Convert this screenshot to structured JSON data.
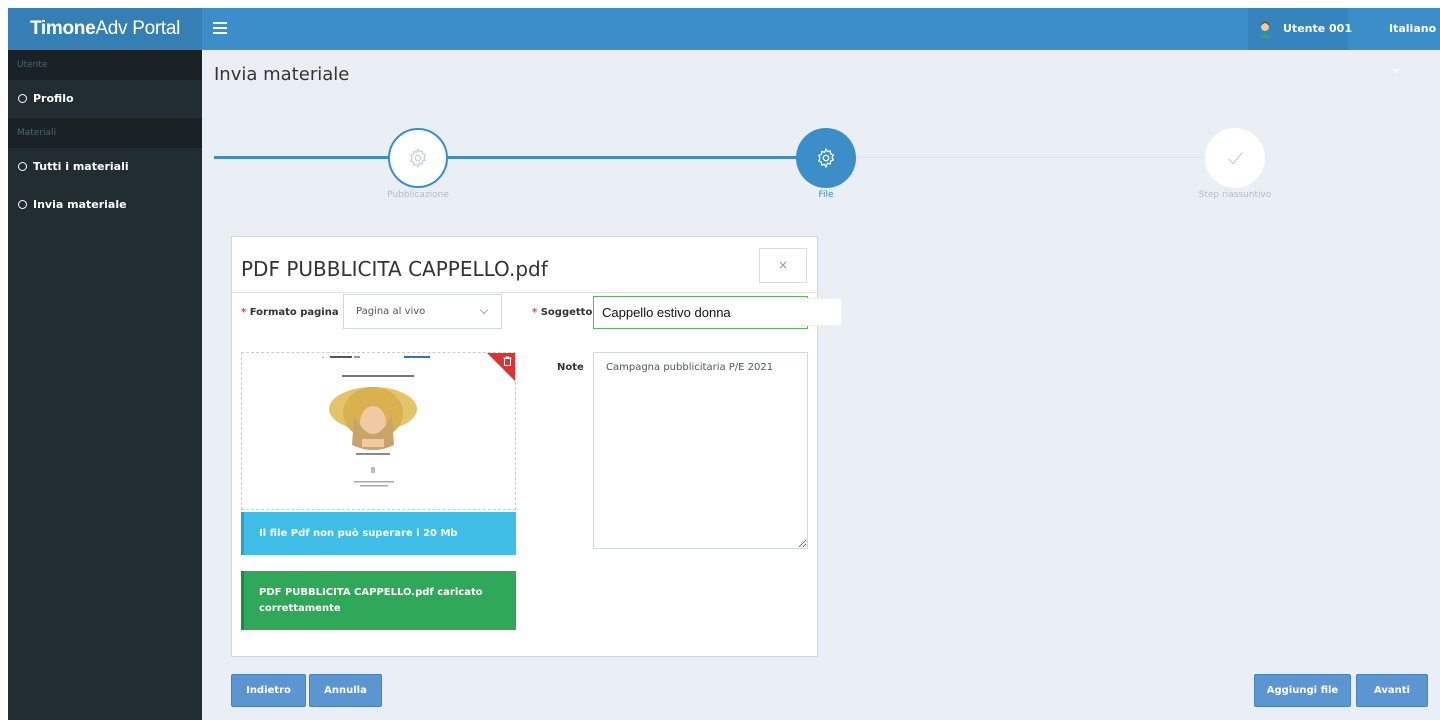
{
  "app": {
    "brand_bold": "Timone",
    "brand_light": "Adv Portal"
  },
  "header": {
    "user_name": "Utente 001",
    "language": "Italiano"
  },
  "sidebar": {
    "sections": [
      {
        "label": "Utente",
        "items": [
          {
            "label": "Profilo"
          }
        ]
      },
      {
        "label": "Materiali",
        "items": [
          {
            "label": "Tutti i materiali"
          },
          {
            "label": "Invia materiale"
          }
        ]
      }
    ]
  },
  "page": {
    "title": "Invia materiale"
  },
  "stepper": {
    "steps": [
      {
        "label": "Pubblicazione",
        "state": "done",
        "icon": "gear-icon"
      },
      {
        "label": "File",
        "state": "active",
        "icon": "gear-icon"
      },
      {
        "label": "Step riassuntivo",
        "state": "pending",
        "icon": "check-icon"
      }
    ]
  },
  "file_card": {
    "title": "PDF PUBBLICITA CAPPELLO.pdf",
    "close_label": "×",
    "formato_label": "Formato pagina",
    "formato_value": "Pagina al vivo",
    "soggetto_label": "Soggetto",
    "soggetto_value": "Cappello estivo donna",
    "note_label": "Note",
    "note_value": "Campagna pubblicitaria P/E 2021",
    "required_mark": "*",
    "info_alert": "Il file Pdf non può superare i 20 Mb",
    "success_alert": "PDF PUBBLICITA CAPPELLO.pdf caricato correttamente"
  },
  "footer_buttons": {
    "back": "Indietro",
    "cancel": "Annulla",
    "add_file": "Aggiungi file",
    "next": "Avanti"
  },
  "colors": {
    "primary": "#3b8ec8",
    "sidebar": "#222d32",
    "info": "#3fbde6",
    "success": "#2fa85a",
    "danger": "#dd3333"
  }
}
